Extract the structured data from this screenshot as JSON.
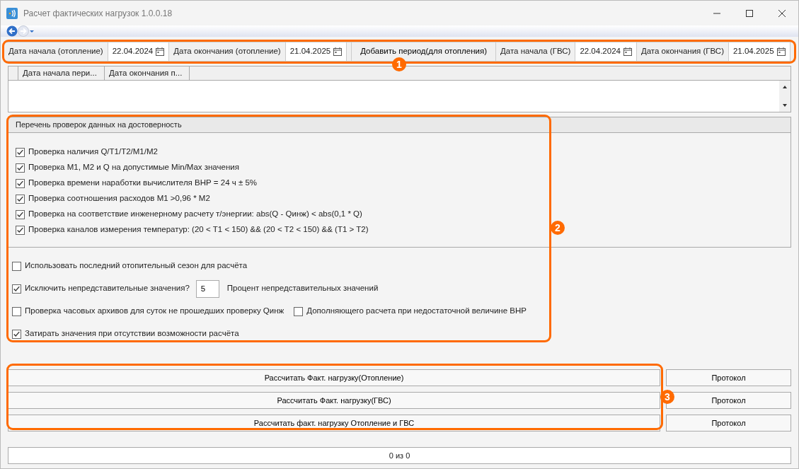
{
  "window": {
    "title": "Расчет фактических нагрузок 1.0.0.18"
  },
  "date_toolbar": [
    {
      "kind": "label",
      "text": "Дата начала (отопление)"
    },
    {
      "kind": "date",
      "value": "22.04.2024"
    },
    {
      "kind": "label",
      "text": "Дата окончания (отопление)"
    },
    {
      "kind": "date",
      "value": "21.04.2025"
    },
    {
      "kind": "button",
      "text": "Добавить период(для отопления)"
    },
    {
      "kind": "label",
      "text": "Дата начала (ГВС)"
    },
    {
      "kind": "date",
      "value": "22.04.2024"
    },
    {
      "kind": "label",
      "text": "Дата окончания (ГВС)"
    },
    {
      "kind": "date",
      "value": "21.04.2025"
    }
  ],
  "periods_table": {
    "columns": [
      "Дата начала пери...",
      "Дата окончания п..."
    ]
  },
  "checks_panel": {
    "title": "Перечень проверок данных на достоверность",
    "checks": [
      {
        "label": "Проверка наличия Q/T1/T2/M1/M2",
        "checked": true
      },
      {
        "label": "Проверка M1, M2 и Q на допустимые Min/Max значения",
        "checked": true
      },
      {
        "label": "Проверка времени наработки вычислителя ВНР = 24 ч ± 5%",
        "checked": true
      },
      {
        "label": "Проверка соотношения расходов M1 >0,96 * M2",
        "checked": true
      },
      {
        "label": "Проверка на соответствие инженерному расчету т/энергии: abs(Q - Qинж) < abs(0,1 * Q)",
        "checked": true
      },
      {
        "label": "Проверка каналов измерения температур: (20 < T1 < 150) && (20 < T2 < 150) && (T1 > T2)",
        "checked": true
      }
    ]
  },
  "options": [
    [
      {
        "kind": "checkbox",
        "label": "Использовать последний отопительный сезон для расчёта",
        "checked": false
      }
    ],
    [
      {
        "kind": "checkbox",
        "label": "Исключить непредставительные значения?",
        "checked": true
      },
      {
        "kind": "number",
        "value": "5"
      },
      {
        "kind": "text",
        "label": "Процент непредставительных значений"
      }
    ],
    [
      {
        "kind": "checkbox",
        "label": "Проверка часовых архивов для суток не прошедших проверку Qинж",
        "checked": false
      },
      {
        "kind": "checkbox",
        "label": "Дополняющего расчета при недостаточной величине ВНР",
        "checked": false
      }
    ],
    [
      {
        "kind": "checkbox",
        "label": "Затирать значения при отсутствии возможности расчёта",
        "checked": true
      }
    ]
  ],
  "actions": [
    {
      "calculate": "Рассчитать Факт. нагрузку(Отопление)",
      "protocol": "Протокол"
    },
    {
      "calculate": "Рассчитать Факт. нагрузку(ГВС)",
      "protocol": "Протокол"
    },
    {
      "calculate": "Рассчитать факт. нагрузку Отопление и ГВС",
      "protocol": "Протокол"
    }
  ],
  "progress": {
    "text": "0 из 0",
    "level": 0
  },
  "callouts": [
    {
      "label": "1"
    },
    {
      "label": "2"
    },
    {
      "label": "3"
    }
  ]
}
